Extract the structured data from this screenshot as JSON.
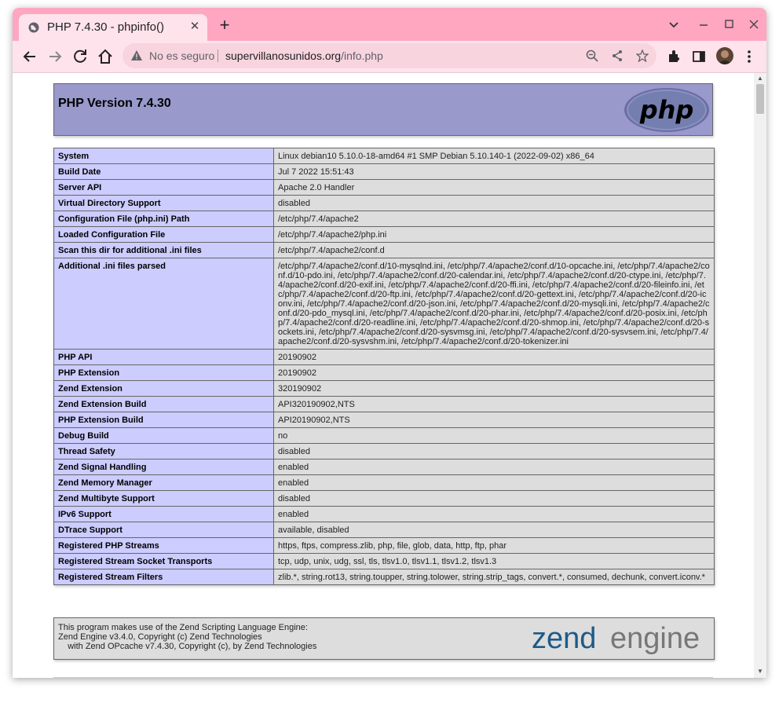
{
  "browser": {
    "tab_title": "PHP 7.4.30 - phpinfo()",
    "tab_close": "✕",
    "new_tab": "+",
    "security_text": "No es seguro",
    "url_host": "supervillanosunidos.org",
    "url_path": "/info.php"
  },
  "page": {
    "title": "PHP Version 7.4.30",
    "logo_text": "php",
    "rows": [
      {
        "key": "System",
        "value": "Linux debian10 5.10.0-18-amd64 #1 SMP Debian 5.10.140-1 (2022-09-02) x86_64"
      },
      {
        "key": "Build Date",
        "value": "Jul 7 2022 15:51:43"
      },
      {
        "key": "Server API",
        "value": "Apache 2.0 Handler"
      },
      {
        "key": "Virtual Directory Support",
        "value": "disabled"
      },
      {
        "key": "Configuration File (php.ini) Path",
        "value": "/etc/php/7.4/apache2"
      },
      {
        "key": "Loaded Configuration File",
        "value": "/etc/php/7.4/apache2/php.ini"
      },
      {
        "key": "Scan this dir for additional .ini files",
        "value": "/etc/php/7.4/apache2/conf.d"
      },
      {
        "key": "Additional .ini files parsed",
        "value": "/etc/php/7.4/apache2/conf.d/10-mysqlnd.ini, /etc/php/7.4/apache2/conf.d/10-opcache.ini, /etc/php/7.4/apache2/conf.d/10-pdo.ini, /etc/php/7.4/apache2/conf.d/20-calendar.ini, /etc/php/7.4/apache2/conf.d/20-ctype.ini, /etc/php/7.4/apache2/conf.d/20-exif.ini, /etc/php/7.4/apache2/conf.d/20-ffi.ini, /etc/php/7.4/apache2/conf.d/20-fileinfo.ini, /etc/php/7.4/apache2/conf.d/20-ftp.ini, /etc/php/7.4/apache2/conf.d/20-gettext.ini, /etc/php/7.4/apache2/conf.d/20-iconv.ini, /etc/php/7.4/apache2/conf.d/20-json.ini, /etc/php/7.4/apache2/conf.d/20-mysqli.ini, /etc/php/7.4/apache2/conf.d/20-pdo_mysql.ini, /etc/php/7.4/apache2/conf.d/20-phar.ini, /etc/php/7.4/apache2/conf.d/20-posix.ini, /etc/php/7.4/apache2/conf.d/20-readline.ini, /etc/php/7.4/apache2/conf.d/20-shmop.ini, /etc/php/7.4/apache2/conf.d/20-sockets.ini, /etc/php/7.4/apache2/conf.d/20-sysvmsg.ini, /etc/php/7.4/apache2/conf.d/20-sysvsem.ini, /etc/php/7.4/apache2/conf.d/20-sysvshm.ini, /etc/php/7.4/apache2/conf.d/20-tokenizer.ini"
      },
      {
        "key": "PHP API",
        "value": "20190902"
      },
      {
        "key": "PHP Extension",
        "value": "20190902"
      },
      {
        "key": "Zend Extension",
        "value": "320190902"
      },
      {
        "key": "Zend Extension Build",
        "value": "API320190902,NTS"
      },
      {
        "key": "PHP Extension Build",
        "value": "API20190902,NTS"
      },
      {
        "key": "Debug Build",
        "value": "no"
      },
      {
        "key": "Thread Safety",
        "value": "disabled"
      },
      {
        "key": "Zend Signal Handling",
        "value": "enabled"
      },
      {
        "key": "Zend Memory Manager",
        "value": "enabled"
      },
      {
        "key": "Zend Multibyte Support",
        "value": "disabled"
      },
      {
        "key": "IPv6 Support",
        "value": "enabled"
      },
      {
        "key": "DTrace Support",
        "value": "available, disabled"
      },
      {
        "key": "Registered PHP Streams",
        "value": "https, ftps, compress.zlib, php, file, glob, data, http, ftp, phar"
      },
      {
        "key": "Registered Stream Socket Transports",
        "value": "tcp, udp, unix, udg, ssl, tls, tlsv1.0, tlsv1.1, tlsv1.2, tlsv1.3"
      },
      {
        "key": "Registered Stream Filters",
        "value": "zlib.*, string.rot13, string.toupper, string.tolower, string.strip_tags, convert.*, consumed, dechunk, convert.iconv.*"
      }
    ],
    "credits": {
      "line1": "This program makes use of the Zend Scripting Language Engine:",
      "line2": "Zend Engine v3.4.0, Copyright (c) Zend Technologies",
      "line3": "    with Zend OPcache v7.4.30, Copyright (c), by Zend Technologies",
      "logo_word1": "zend",
      "logo_word2": "engine"
    }
  },
  "colors": {
    "titlebar": "#ffa6c1",
    "toolbar": "#ffe3ec",
    "header_bg": "#9999cc",
    "key_cell": "#ccccff",
    "value_cell": "#dddddd"
  }
}
